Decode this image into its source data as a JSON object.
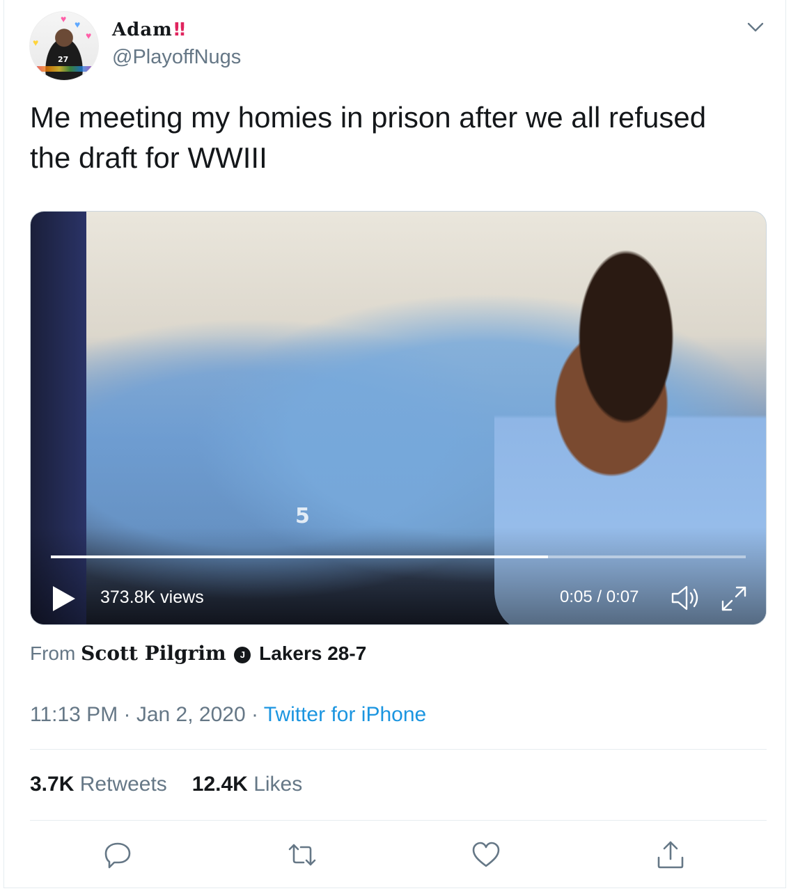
{
  "tweet": {
    "author": {
      "name": "Adam",
      "name_emoji": "‼",
      "handle": "@PlayoffNugs",
      "avatar_jersey": "27"
    },
    "text": "Me meeting my homies in prison after we all refused the draft for WWIII",
    "video": {
      "views": "373.8K views",
      "time": "0:05 / 0:07",
      "progress": 0.715,
      "jersey_text": "5"
    },
    "source": {
      "from_label": "From",
      "account_name": "Scott Pilgrim",
      "badge_glyph": "J",
      "account_suffix": "Lakers 28-7"
    },
    "timestamp": "11:13 PM · Jan 2, 2020 · ",
    "client": "Twitter for iPhone",
    "stats": {
      "retweets_count": "3.7K",
      "retweets_label": "Retweets",
      "likes_count": "12.4K",
      "likes_label": "Likes"
    }
  },
  "icons": [
    "chevron-down-icon",
    "play-icon",
    "volume-icon",
    "fullscreen-icon",
    "reply-icon",
    "retweet-icon",
    "like-icon",
    "share-icon"
  ],
  "colors": {
    "link": "#1b95e0",
    "secondary_text": "#657786",
    "primary_text": "#14171a",
    "divider": "#e6ecf0",
    "emoji": "#e0245e"
  }
}
